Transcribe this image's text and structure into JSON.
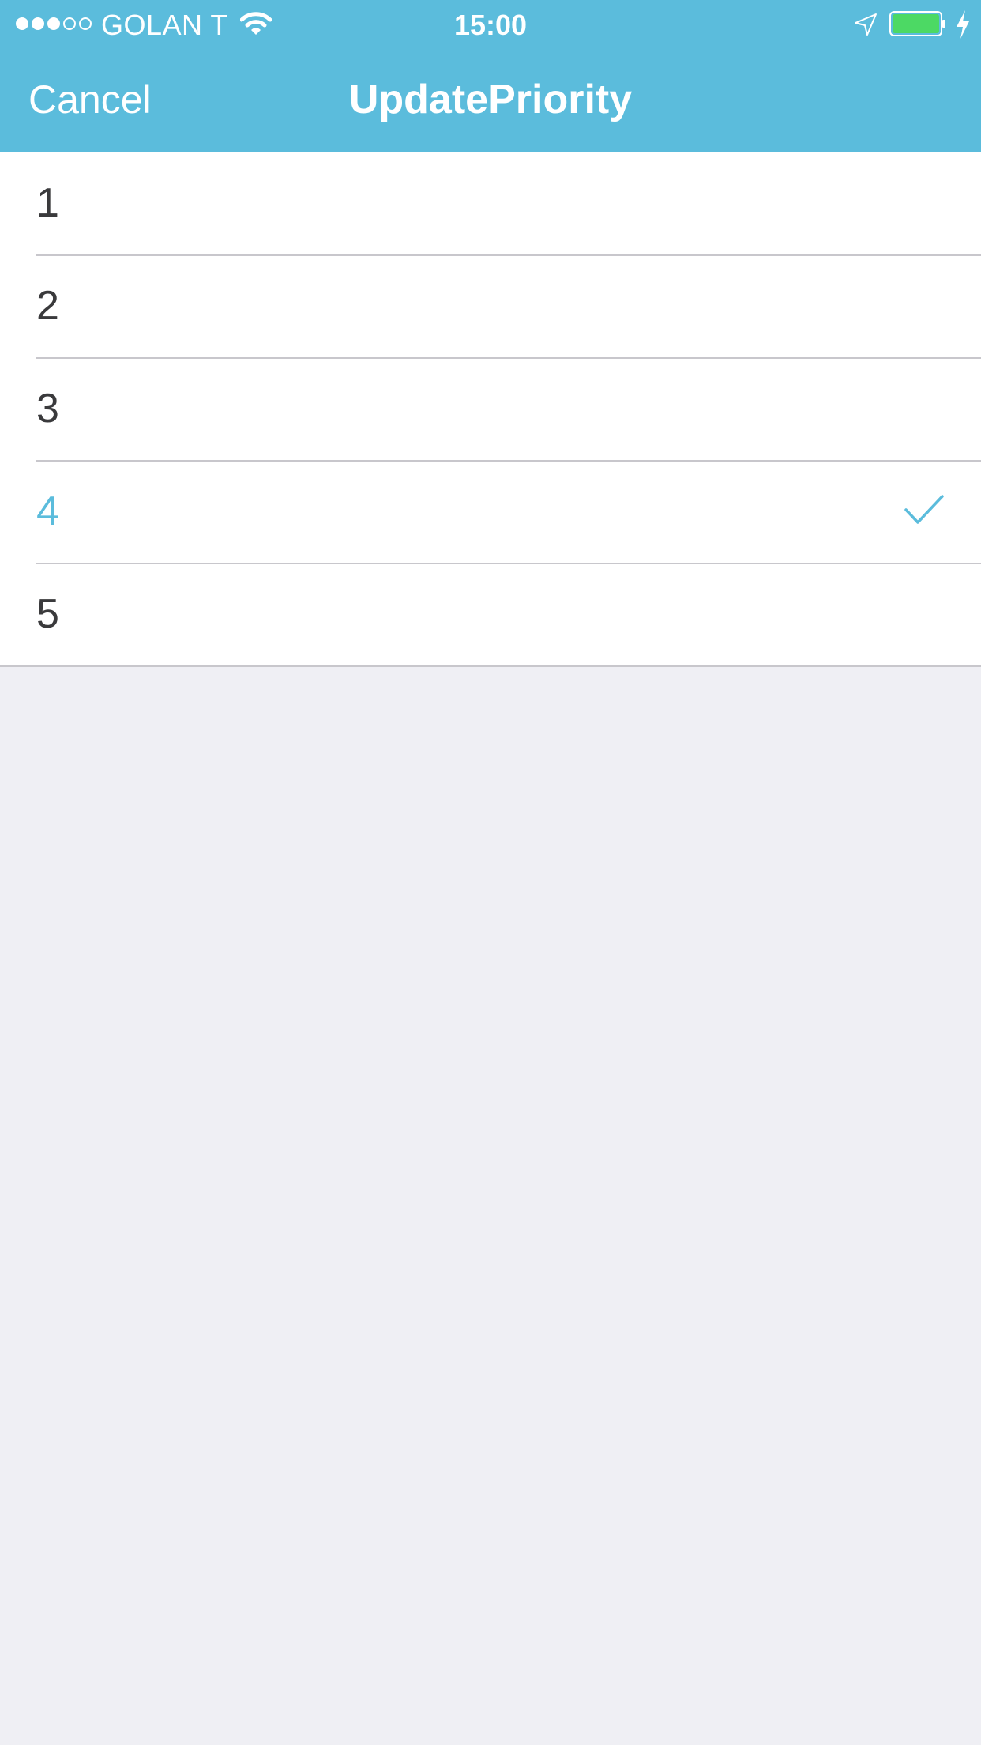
{
  "status_bar": {
    "signal_bars_filled": 3,
    "signal_bars_total": 5,
    "carrier": "GOLAN T",
    "time": "15:00",
    "battery_level": 1.0,
    "charging": true,
    "icons": [
      "wifi-icon",
      "location-arrow-icon",
      "battery-icon",
      "charging-bolt-icon"
    ]
  },
  "nav": {
    "cancel_label": "Cancel",
    "title": "UpdatePriority"
  },
  "priority_options": [
    {
      "label": "1",
      "selected": false
    },
    {
      "label": "2",
      "selected": false
    },
    {
      "label": "3",
      "selected": false
    },
    {
      "label": "4",
      "selected": true
    },
    {
      "label": "5",
      "selected": false
    }
  ],
  "selected_icon": "checkmark-icon",
  "colors": {
    "accent": "#5bbcdc",
    "battery_fill": "#4cd964",
    "background": "#efeff4",
    "text": "#3a3a3c",
    "separator": "#c8c7cc"
  }
}
